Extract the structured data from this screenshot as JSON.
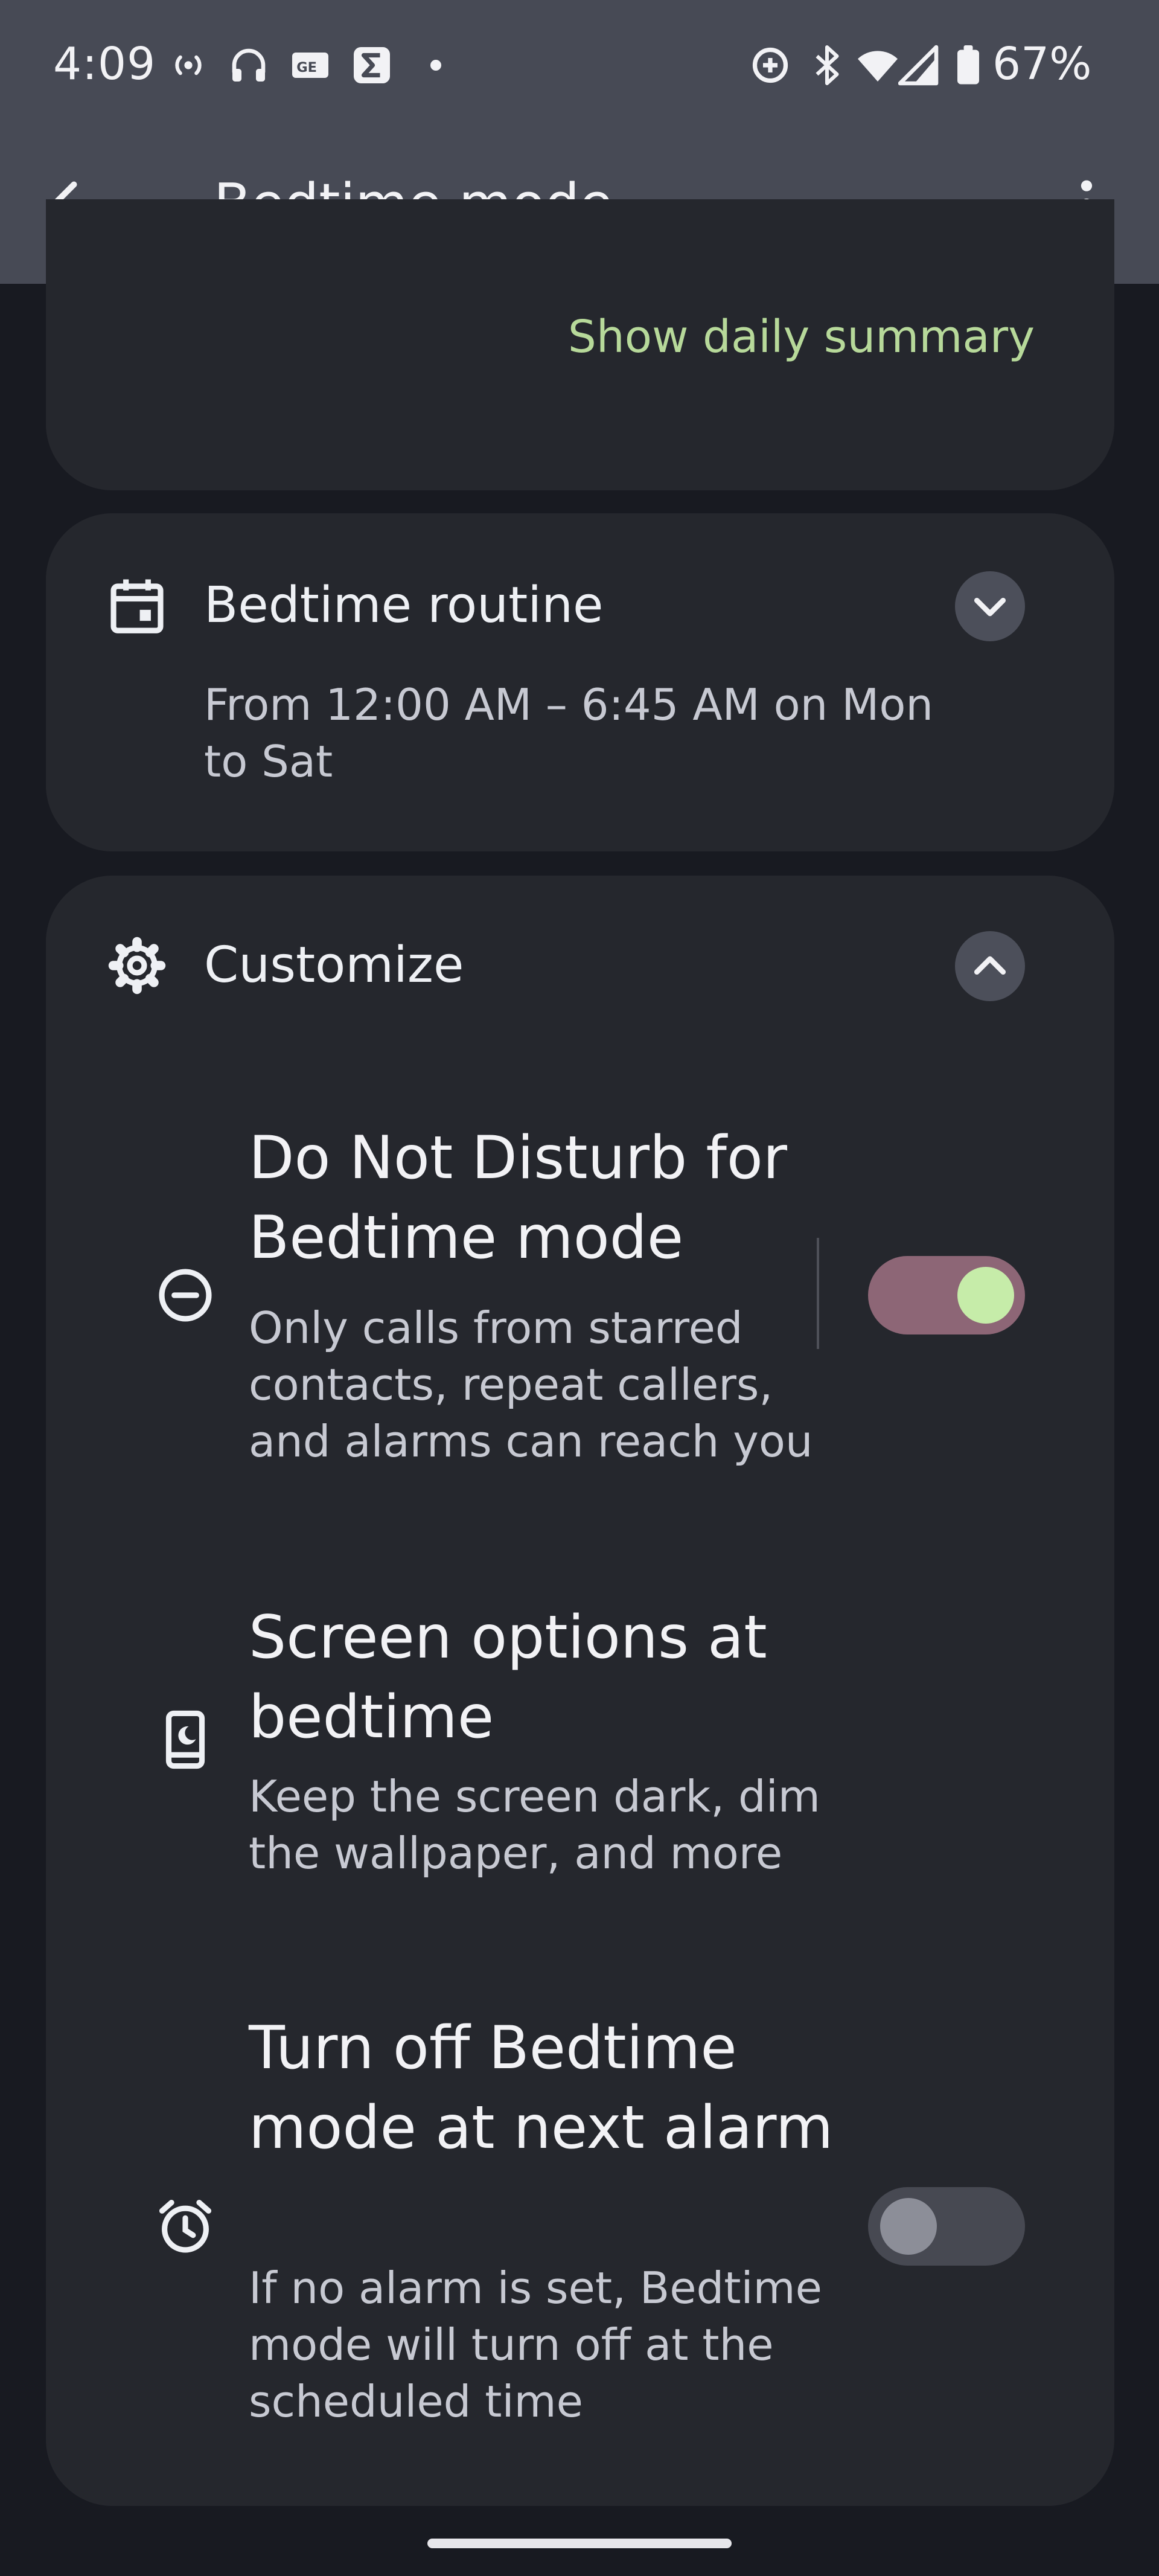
{
  "status_bar": {
    "time": "4:09",
    "battery_text": "67%",
    "left_icons": [
      "hotspot-icon",
      "headphones-icon",
      "news-app-icon",
      "sigma-app-icon",
      "dot-icon"
    ],
    "right_icons": [
      "data-saver-icon",
      "bluetooth-icon",
      "wifi-icon",
      "cellular-signal-icon",
      "battery-icon"
    ]
  },
  "toolbar": {
    "title": "Bedtime mode",
    "back_icon": "arrow-back-icon",
    "more_icon": "more-vert-icon"
  },
  "summary_card": {
    "link_label": "Show daily summary"
  },
  "routine_card": {
    "title": "Bedtime routine",
    "subtitle": "From 12:00 AM – 6:45 AM on Mon to Sat",
    "expanded": false
  },
  "customize_card": {
    "title": "Customize",
    "expanded": true,
    "settings": [
      {
        "title": "Do Not Disturb for Bedtime mode",
        "description": "Only calls from starred contacts, repeat callers, and alarms can reach you",
        "icon": "do-not-disturb-icon",
        "toggle": true
      },
      {
        "title": "Screen options at bedtime",
        "description": "Keep the screen dark, dim the wallpaper, and more",
        "icon": "phone-bedtime-icon"
      },
      {
        "title": "Turn off Bedtime mode at next alarm",
        "description": "If no alarm is set, Bedtime mode will turn off at the scheduled time",
        "icon": "alarm-icon",
        "toggle": false
      }
    ]
  },
  "colors": {
    "accent_link": "#b7d99a",
    "toggle_on_track": "#8d6676",
    "toggle_on_knob": "#c6eca9",
    "card_background": "#25272d",
    "header_background": "#474a55"
  }
}
